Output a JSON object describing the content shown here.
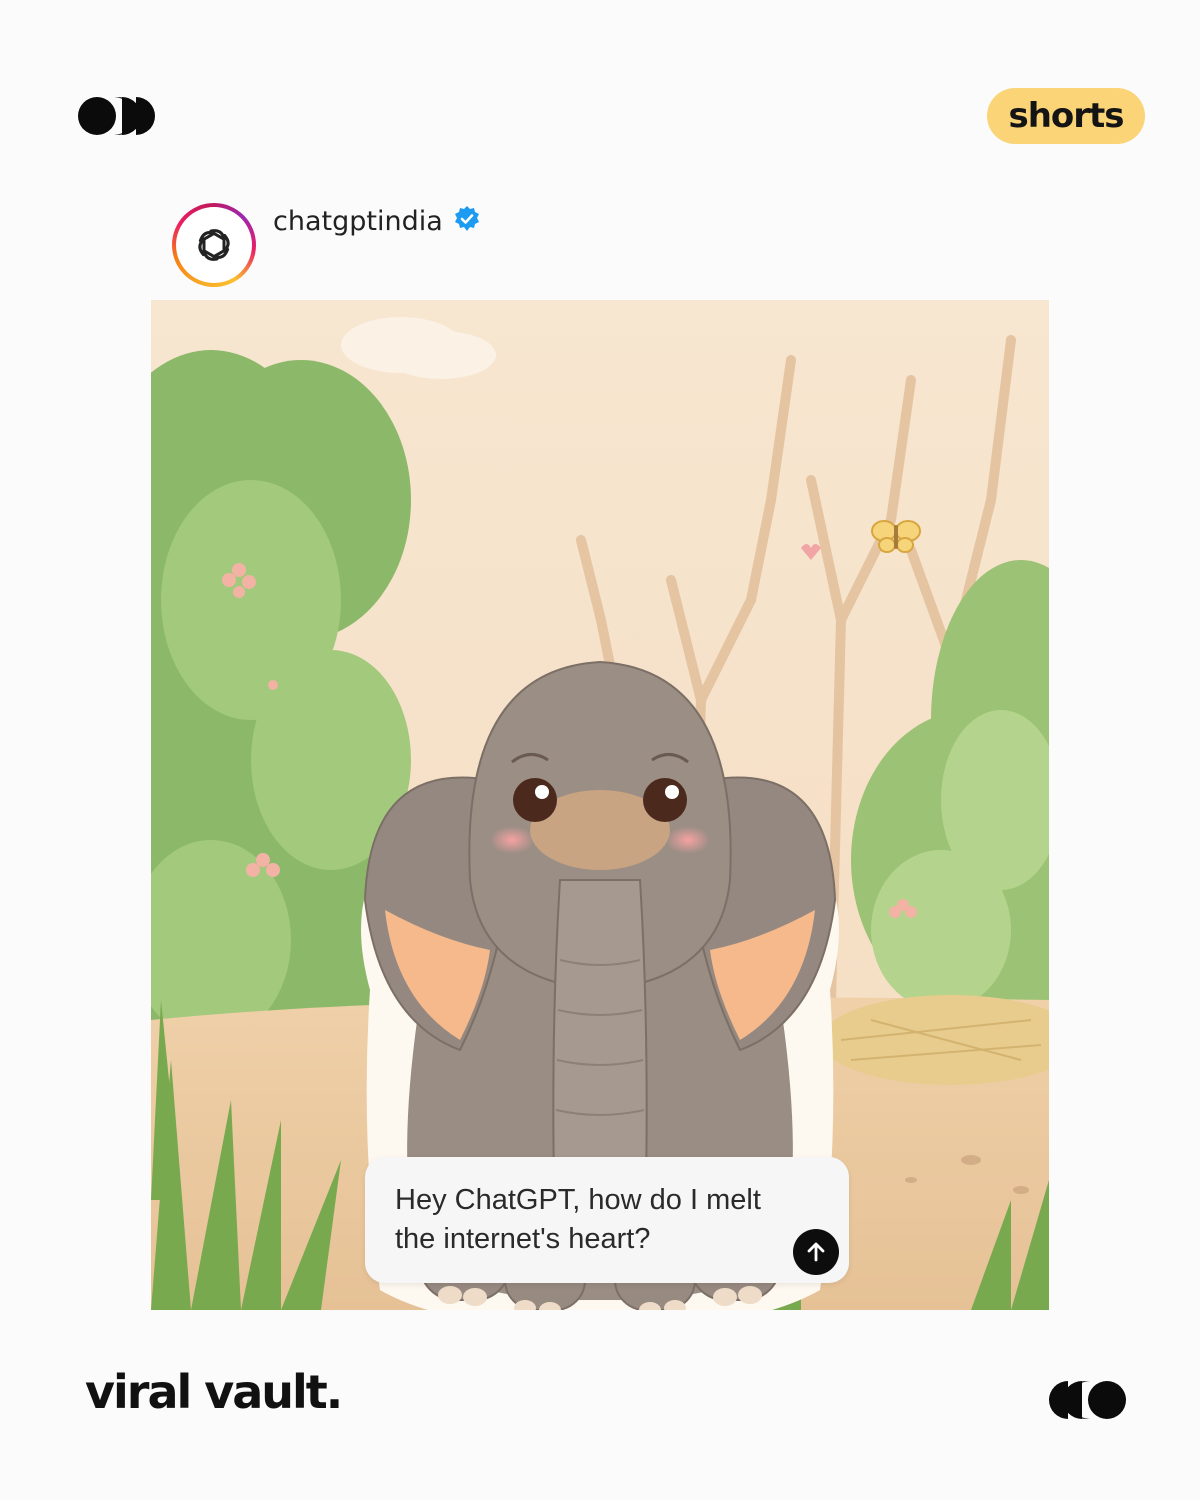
{
  "header": {
    "logo_icon": "dots-logo-icon",
    "badge_label": "shorts",
    "badge_color": "#fbd477"
  },
  "post": {
    "username": "chatgptindia",
    "verified_icon": "verified-badge-icon",
    "avatar_icon": "openai-logo-icon",
    "image_icon": "baby-elephant-illustration",
    "prompt": {
      "text": "Hey ChatGPT, how do I melt the internet's heart?",
      "send_icon": "arrow-up-icon"
    }
  },
  "footer": {
    "brand": "viral vault.",
    "logo_icon": "dots-logo-reversed-icon"
  }
}
